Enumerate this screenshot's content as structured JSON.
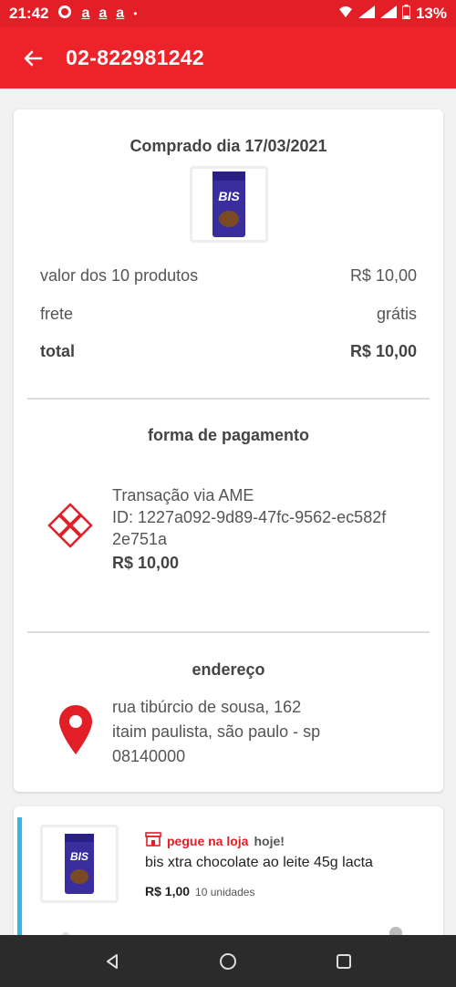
{
  "status_bar": {
    "time": "21:42",
    "glyphs": [
      "a",
      "a",
      "a"
    ],
    "dot": "•",
    "battery": "13%"
  },
  "app_bar": {
    "title": "02-822981242"
  },
  "order": {
    "purchased_label": "Comprado dia 17/03/2021",
    "product_thumb_text": "BIS",
    "summary": [
      {
        "label": "valor dos 10 produtos",
        "value": "R$ 10,00"
      },
      {
        "label": "frete",
        "value": "grátis"
      },
      {
        "label": "total",
        "value": "R$ 10,00"
      }
    ]
  },
  "payment": {
    "title": "forma de pagamento",
    "method": "Transação via AME",
    "id_line1": "ID: 1227a092-9d89-47fc-9562-ec582f",
    "id_line2": "2e751a",
    "amount": "R$ 10,00"
  },
  "address": {
    "title": "endereço",
    "line1": "rua tibúrcio de sousa, 162",
    "line2": "itaim paulista, são paulo - sp",
    "line3": "08140000"
  },
  "item": {
    "pickup_label": "pegue na loja",
    "pickup_when": "hoje!",
    "name": "bis xtra chocolate ao leite 45g lacta",
    "price": "R$ 1,00",
    "units": "10 unidades",
    "thumb_text": "BIS"
  },
  "colors": {
    "brand_red": "#ee2229",
    "accent_blue": "#2fb9e3"
  },
  "icons": {
    "back": "arrow-left-icon",
    "payment": "ame-logo-icon",
    "address": "location-pin-icon",
    "pickup": "store-icon"
  }
}
